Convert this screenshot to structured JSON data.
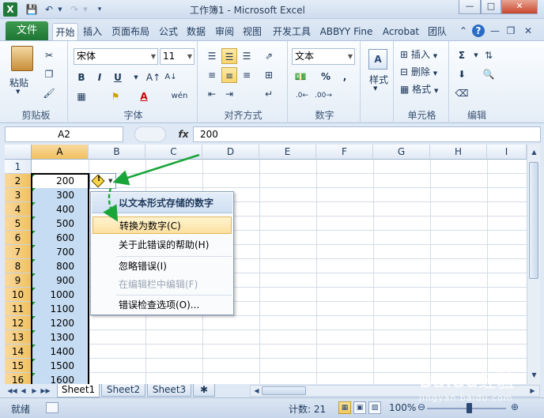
{
  "window": {
    "title": "工作簿1  -  Microsoft Excel",
    "app_icon": "X"
  },
  "quick_access": {
    "save_icon": "save-icon",
    "undo_icon": "undo-icon",
    "redo_icon": "redo-icon"
  },
  "ribbon_tabs": [
    "文件",
    "开始",
    "插入",
    "页面布局",
    "公式",
    "数据",
    "审阅",
    "视图",
    "开发工具",
    "ABBYY Fine",
    "Acrobat",
    "团队"
  ],
  "ribbon": {
    "clipboard": {
      "label": "剪贴板",
      "paste": "粘贴"
    },
    "font": {
      "label": "字体",
      "font_name": "宋体",
      "font_size": "11",
      "bold": "B",
      "italic": "I",
      "underline": "U",
      "font_color_letter": "A",
      "wen": "wén"
    },
    "alignment": {
      "label": "对齐方式"
    },
    "number": {
      "label": "数字",
      "format": "文本",
      "percent": "%",
      "comma": ","
    },
    "styles": {
      "label": "样式"
    },
    "cells": {
      "label": "单元格",
      "insert": "插入",
      "delete": "删除",
      "format": "格式"
    },
    "editing": {
      "label": "编辑",
      "sum": "Σ"
    }
  },
  "formula_bar": {
    "name_box": "A2",
    "fx": "fx",
    "content": "200"
  },
  "columns": [
    "A",
    "B",
    "C",
    "D",
    "E",
    "F",
    "G",
    "H",
    "I"
  ],
  "rows": [
    "1",
    "2",
    "3",
    "4",
    "5",
    "6",
    "7",
    "8",
    "9",
    "10",
    "11",
    "12",
    "13",
    "14",
    "15",
    "16"
  ],
  "cells_A": [
    "",
    "200",
    "300",
    "400",
    "500",
    "600",
    "700",
    "800",
    "900",
    "1000",
    "1100",
    "1200",
    "1300",
    "1400",
    "1500",
    "1600"
  ],
  "error_menu": {
    "header": "以文本形式存储的数字",
    "items": [
      {
        "label": "转换为数字(C)",
        "state": "hover"
      },
      {
        "label": "关于此错误的帮助(H)",
        "state": "normal"
      },
      {
        "label": "忽略错误(I)",
        "state": "normal"
      },
      {
        "label": "在编辑栏中编辑(F)",
        "state": "disabled"
      },
      {
        "label": "错误检查选项(O)...",
        "state": "normal"
      }
    ]
  },
  "sheets": [
    "Sheet1",
    "Sheet2",
    "Sheet3"
  ],
  "status_bar": {
    "mode": "就绪",
    "count": "计数: 21",
    "zoom": "100%"
  },
  "watermark": {
    "text": "Baidu经验",
    "sub": "jingyan.baidu.com"
  },
  "colors": {
    "file_tab": "#1e7634",
    "selection": "#c6dcf3",
    "arrow": "#1aa53a"
  }
}
